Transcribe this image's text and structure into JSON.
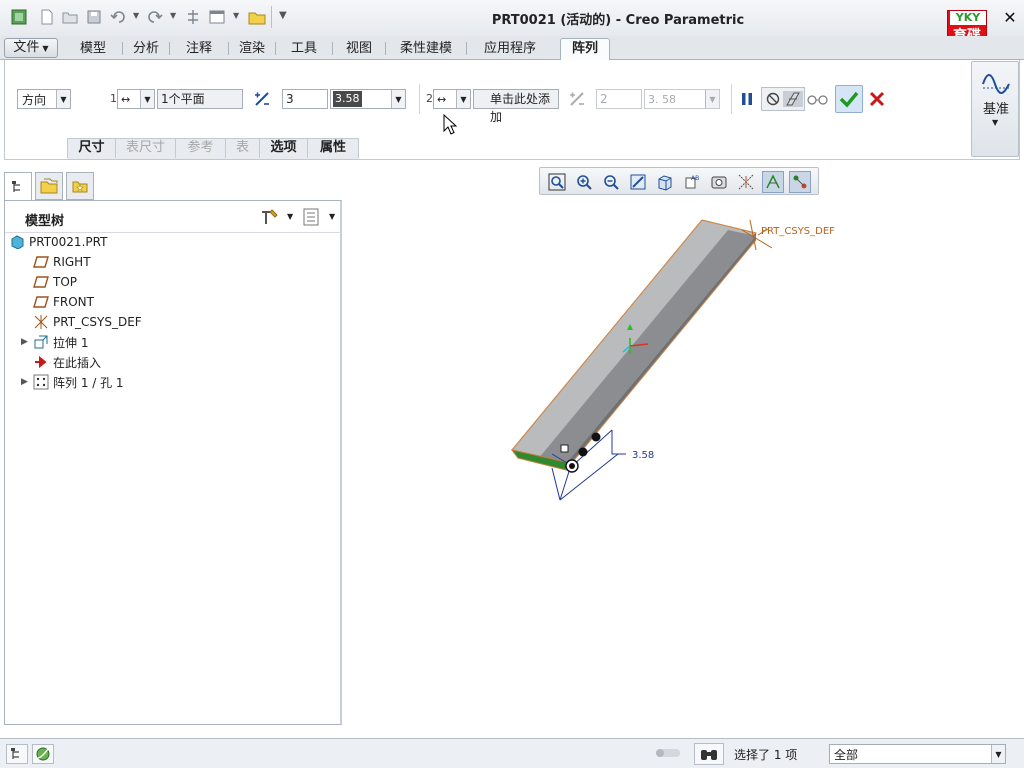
{
  "window": {
    "title": "PRT0021 (活动的) - Creo Parametric",
    "logo_text_top": "YKY",
    "logo_text": "育碟软件"
  },
  "quick_access": [
    "new-icon",
    "open-icon",
    "save-icon",
    "undo-icon",
    "redo-icon",
    "regenerate-icon",
    "windows-icon",
    "folder-icon",
    "customize-icon"
  ],
  "menu": {
    "file": "文件",
    "tabs": [
      "模型",
      "分析",
      "注释",
      "渲染",
      "工具",
      "视图",
      "柔性建模",
      "应用程序"
    ],
    "active_tab": "阵列"
  },
  "pattern_dashboard": {
    "type_select": "方向",
    "dir1_index": "1",
    "dir1_reference": "1个平面",
    "dir1_count": "3",
    "dir1_spacing": "3.58",
    "dir2_index": "2",
    "dir2_reference": "单击此处添加",
    "dir2_count": "2",
    "dir2_spacing": "3. 58",
    "subtabs": [
      {
        "label": "尺寸",
        "enabled": true
      },
      {
        "label": "表尺寸",
        "enabled": false
      },
      {
        "label": "参考",
        "enabled": false
      },
      {
        "label": "表",
        "enabled": false
      },
      {
        "label": "选项",
        "enabled": true
      },
      {
        "label": "属性",
        "enabled": true
      }
    ],
    "datum_label": "基准"
  },
  "model_tree": {
    "title": "模型树",
    "items": [
      {
        "label": "PRT0021.PRT",
        "icon": "part-icon",
        "indent": 0,
        "expander": ""
      },
      {
        "label": "RIGHT",
        "icon": "datum-plane-icon",
        "indent": 1,
        "expander": ""
      },
      {
        "label": "TOP",
        "icon": "datum-plane-icon",
        "indent": 1,
        "expander": ""
      },
      {
        "label": "FRONT",
        "icon": "datum-plane-icon",
        "indent": 1,
        "expander": ""
      },
      {
        "label": "PRT_CSYS_DEF",
        "icon": "csys-icon",
        "indent": 1,
        "expander": ""
      },
      {
        "label": "拉伸 1",
        "icon": "extrude-icon",
        "indent": 1,
        "expander": "▶"
      },
      {
        "label": "在此插入",
        "icon": "insert-here-icon",
        "indent": 1,
        "expander": ""
      },
      {
        "label": "阵列 1 / 孔 1",
        "icon": "pattern-icon",
        "indent": 1,
        "expander": "▶"
      }
    ]
  },
  "viewport": {
    "csys_label": "PRT_CSYS_DEF",
    "dimension_value": "3.58"
  },
  "status": {
    "selection_text": "选择了 1 项",
    "filter_value": "全部"
  },
  "colors": {
    "accent_blue": "#1f4e9a",
    "confirm_green": "#1d9a1d",
    "cancel_red": "#c81818",
    "model_gray": "#a8aaac",
    "csys_orange": "#b5651d"
  }
}
